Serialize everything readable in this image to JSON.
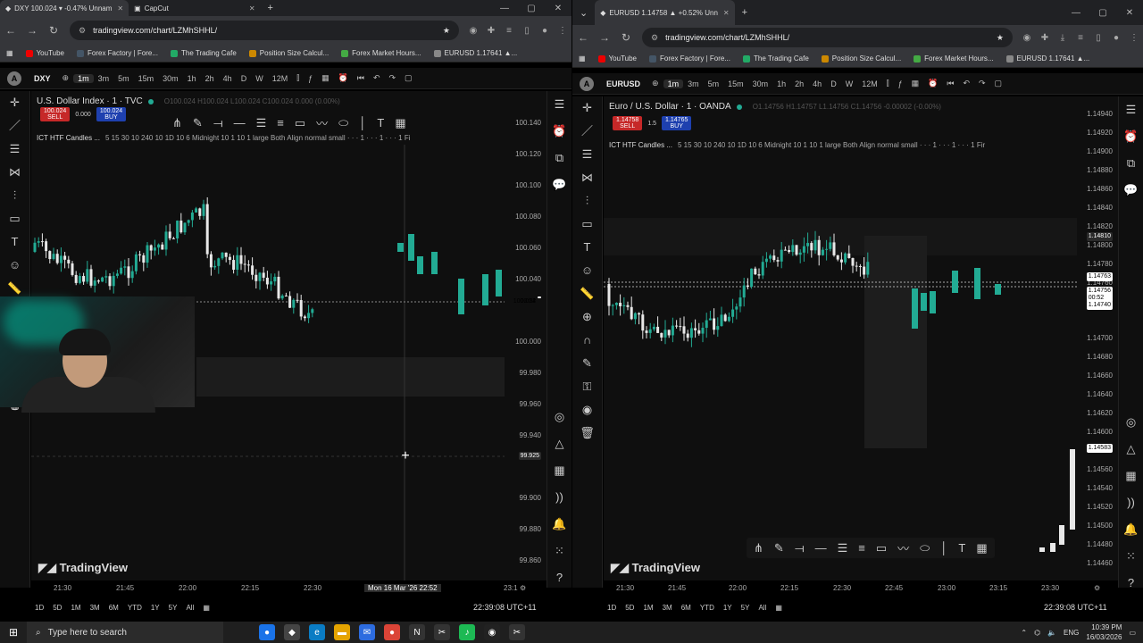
{
  "left": {
    "tabs": [
      {
        "label": "DXY 100.024 ▾ -0.47% Unnam",
        "icon": "tradingview-icon"
      },
      {
        "label": "CapCut",
        "icon": "capcut-icon"
      }
    ],
    "url": "tradingview.com/chart/LZMhSHHL/",
    "bookmarks": [
      "YouTube",
      "Forex Factory | Fore...",
      "The Trading Cafe",
      "Position Size Calcul...",
      "Forex Market Hours...",
      "EURUSD 1.17641 ▲..."
    ],
    "symbol": "DXY",
    "timeframes": [
      "1m",
      "3m",
      "5m",
      "15m",
      "30m",
      "1h",
      "2h",
      "4h",
      "D",
      "W",
      "12M"
    ],
    "active_timeframe": "1m",
    "instrument": "U.S. Dollar Index · 1 · TVC",
    "ohlc": "O100.024 H100.024 L100.024 C100.024 0.000 (0.00%)",
    "sell_price": "100.024",
    "sell_label": "SELL",
    "spread": "0.000",
    "buy_price": "100.024",
    "buy_label": "BUY",
    "indicator_name": "ICT HTF Candles ...",
    "indicator_params": "5 15 30 10 240 10 1D 10 6 Midnight 10 1 10 1 large Both Align normal small · · · 1 · · · 1 · · · 1 Fi",
    "price_ticks": [
      "100.140",
      "100.120",
      "100.100",
      "100.080",
      "100.060",
      "100.040",
      "100.000",
      "99.980",
      "99.960",
      "99.940",
      "99.900",
      "99.880",
      "99.860"
    ],
    "current_price": "100.024",
    "countdown": "00:52",
    "crosshair_price": "99.925",
    "time_ticks": [
      "21:30",
      "21:45",
      "22:00",
      "22:15",
      "22:30",
      "23:1"
    ],
    "crosshair_time": "Mon 16 Mar '26   22:52",
    "ranges": [
      "1D",
      "5D",
      "1M",
      "3M",
      "6M",
      "YTD",
      "1Y",
      "5Y",
      "All"
    ],
    "clock": "22:39:08 UTC+11",
    "brand": "TradingView"
  },
  "right": {
    "tabs": [
      {
        "label": "EURUSD 1.14758 ▲ +0.52% Unn",
        "icon": "tradingview-icon"
      }
    ],
    "url": "tradingview.com/chart/LZMhSHHL/",
    "bookmarks": [
      "YouTube",
      "Forex Factory | Fore...",
      "The Trading Cafe",
      "Position Size Calcul...",
      "Forex Market Hours...",
      "EURUSD 1.17641 ▲..."
    ],
    "symbol": "EURUSD",
    "timeframes": [
      "1m",
      "3m",
      "5m",
      "15m",
      "30m",
      "1h",
      "2h",
      "4h",
      "D",
      "W",
      "12M"
    ],
    "active_timeframe": "1m",
    "instrument": "Euro / U.S. Dollar · 1 · OANDA",
    "ohlc": "O1.14756 H1.14757 L1.14756 C1.14756 -0.00002 (-0.00%)",
    "sell_price": "1.14758",
    "sell_label": "SELL",
    "spread": "1.5",
    "buy_price": "1.14765",
    "buy_label": "BUY",
    "indicator_name": "ICT HTF Candles ...",
    "indicator_params": "5 15 30 10 240 10 1D 10 6 Midnight 10 1 10 1 large Both Align normal small · · · 1 · · · 1 · · · 1 Fir",
    "price_ticks": [
      "1.14940",
      "1.14920",
      "1.14900",
      "1.14880",
      "1.14860",
      "1.14840",
      "1.14820",
      "1.14800",
      "1.14780",
      "1.14760",
      "1.14700",
      "1.14680",
      "1.14660",
      "1.14640",
      "1.14620",
      "1.14600",
      "1.14560",
      "1.14540",
      "1.14520",
      "1.14500",
      "1.14480",
      "1.14460"
    ],
    "price_labels": {
      "p1": "1.14810",
      "p2": "1.14763",
      "p3": "1.14756",
      "countdown": "00:52",
      "p4": "1.14740",
      "p5": "1.14583"
    },
    "time_ticks": [
      "21:30",
      "21:45",
      "22:00",
      "22:15",
      "22:30",
      "22:45",
      "23:00",
      "23:15",
      "23:30"
    ],
    "ranges": [
      "1D",
      "5D",
      "1M",
      "3M",
      "6M",
      "YTD",
      "1Y",
      "5Y",
      "All"
    ],
    "clock": "22:39:08 UTC+11",
    "brand": "TradingView"
  },
  "taskbar": {
    "search_placeholder": "Type here to search",
    "lang": "ENG",
    "time": "10:39 PM",
    "date": "16/03/2026"
  },
  "colors": {
    "bull": "#22ab94",
    "bear": "#e8e8e8",
    "sell": "#c62828",
    "buy": "#1e40af",
    "bg": "#0f0f0f"
  }
}
